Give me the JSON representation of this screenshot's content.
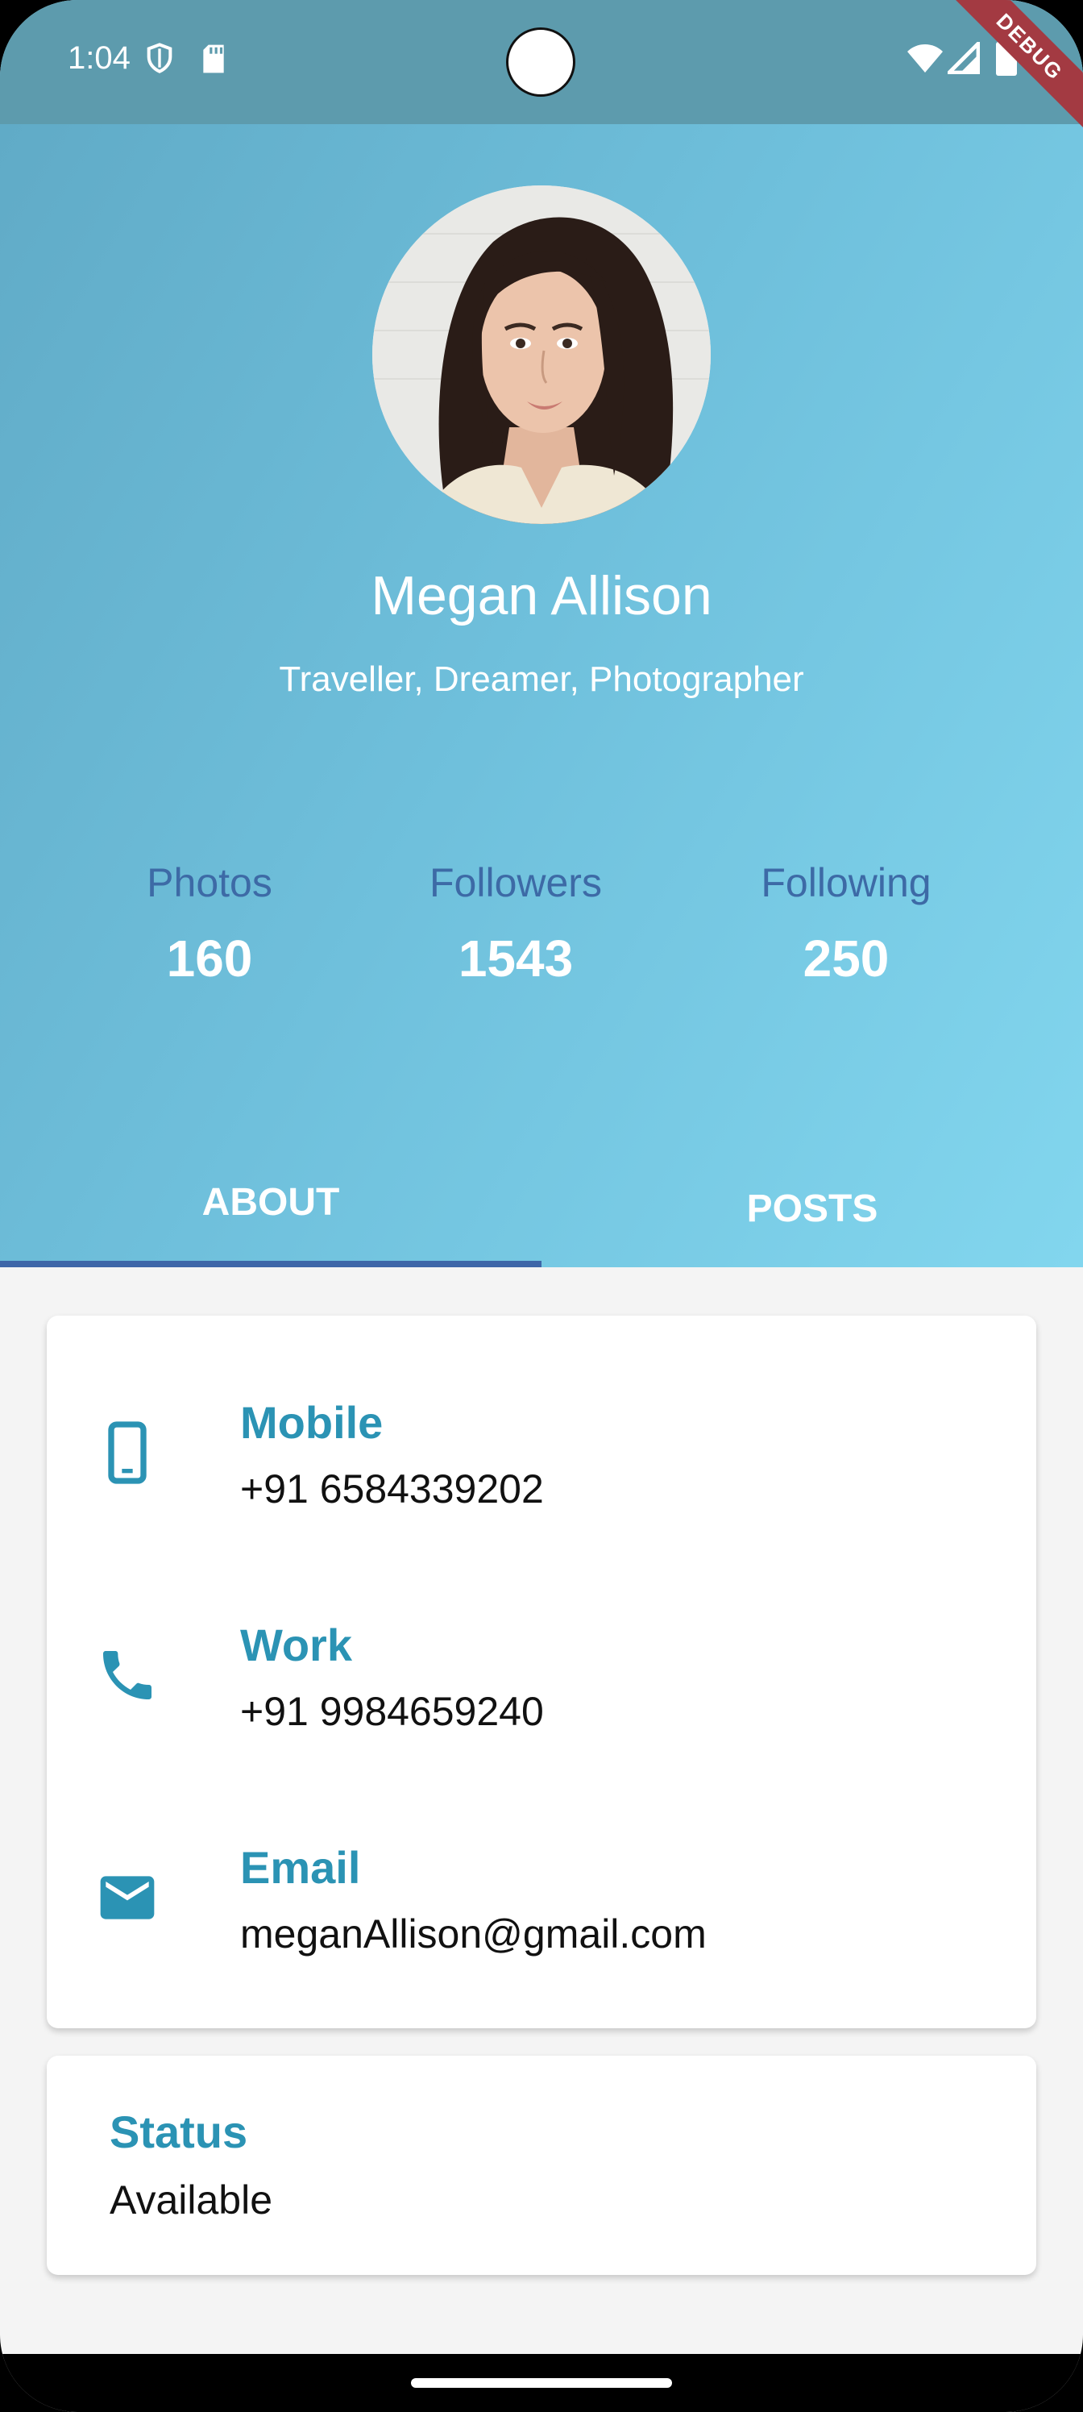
{
  "status_bar": {
    "time": "1:04",
    "debug_label": "DEBUG"
  },
  "profile": {
    "name": "Megan Allison",
    "tagline": "Traveller, Dreamer, Photographer",
    "avatar_icon": "profile-photo"
  },
  "stats": [
    {
      "label": "Photos",
      "value": "160"
    },
    {
      "label": "Followers",
      "value": "1543"
    },
    {
      "label": "Following",
      "value": "250"
    }
  ],
  "tabs": {
    "about": "ABOUT",
    "posts": "POSTS",
    "selected": "ABOUT"
  },
  "contact": [
    {
      "icon": "mobile-phone-icon",
      "label": "Mobile",
      "value": "+91 6584339202"
    },
    {
      "icon": "phone-icon",
      "label": "Work",
      "value": "+91 9984659240"
    },
    {
      "icon": "email-icon",
      "label": "Email",
      "value": "meganAllison@gmail.com"
    }
  ],
  "status": {
    "label": "Status",
    "value": "Available"
  },
  "colors": {
    "accent": "#2b93b4",
    "stat_label": "#3d6aa6",
    "tab_indicator": "#3e66a8",
    "status_bar": "#5d9bad",
    "header_gradient_start": "#5fa9c5",
    "header_gradient_end": "#82d6ee",
    "debug_ribbon": "#a33a42"
  }
}
